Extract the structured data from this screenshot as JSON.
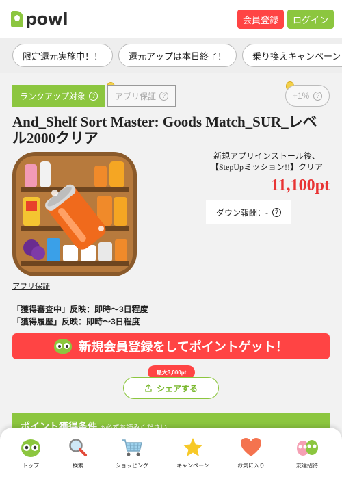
{
  "header": {
    "logo_text": "powl",
    "register_label": "会員登録",
    "login_label": "ログイン"
  },
  "chips": [
    {
      "label": "限定還元実施中！！"
    },
    {
      "label": "還元アップは本日終了！"
    },
    {
      "label": "乗り換えキャンペーン"
    }
  ],
  "offer": {
    "rank_badge": "ランクアップ対象",
    "app_guarantee_badge": "アプリ保証",
    "plus_rate": "+1%",
    "title": "And_Shelf Sort Master: Goods Match_SUR_レベル2000クリア",
    "install_condition_line1": "新規アプリインストール後、",
    "install_condition_line2": "【StepUpミッション!!】クリア",
    "points": "11,100pt",
    "down_reward": "ダウン報酬：-",
    "app_guarantee_link": "アプリ保証",
    "reflect_review": "「獲得審査中」反映：即時～3日程度",
    "reflect_history": "「獲得履歴」反映：即時～3日程度"
  },
  "cta": {
    "label": "新規会員登録をしてポイントゲット！"
  },
  "share": {
    "max_label": "最大3,000pt",
    "button_label": "シェアする"
  },
  "conditions": {
    "title": "ポイント獲得条件",
    "note": "※必ずお読みください"
  },
  "bottom_nav": [
    {
      "label": "トップ"
    },
    {
      "label": "検索"
    },
    {
      "label": "ショッピング"
    },
    {
      "label": "キャンペーン"
    },
    {
      "label": "お気に入り"
    },
    {
      "label": "友達招待"
    }
  ],
  "colors": {
    "brand_green": "#8cc63f",
    "accent_red": "#ff4444",
    "points_red": "#e83434"
  }
}
